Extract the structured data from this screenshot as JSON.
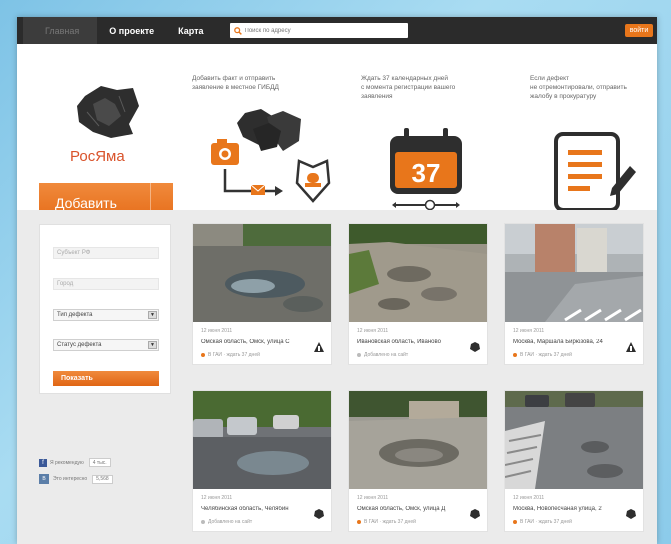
{
  "nav": {
    "tabs": [
      {
        "label": "Главная"
      },
      {
        "label": "О проекте"
      },
      {
        "label": "Карта"
      }
    ],
    "search_placeholder": "Поиск по адресу",
    "login_label": "войти"
  },
  "hero": {
    "logo_text": "РосЯма",
    "add_button": "Добавить",
    "steps": [
      {
        "text": "Добавить факт и отправить\nзаявление в местное ГИБДД"
      },
      {
        "text": "Ждать 37 календарных дней\nс момента регистрации вашего\nзаявления",
        "number": "37"
      },
      {
        "text": "Если дефект\nне отремонтировали, отправить\nжалобу в прокуратуру"
      }
    ]
  },
  "filter": {
    "region_placeholder": "Субъект РФ",
    "city_placeholder": "Город",
    "defect_type": "Тип дефекта",
    "defect_status": "Статус дефекта",
    "show_button": "Показать"
  },
  "social": {
    "fb_label": "Я рекомендую",
    "fb_count": "4 тыс.",
    "vk_label": "Это интересно",
    "vk_count": "5,568"
  },
  "cards": [
    {
      "date": "12 июня 2011",
      "address": "Омская область, Омск, улица С",
      "status": "В ГАИ  ·  ждать 37 дней"
    },
    {
      "date": "12 июня 2011",
      "address": "Ивановская область, Иваново",
      "status": "Добавлено на сайт"
    },
    {
      "date": "12 июня 2011",
      "address": "Москва, Маршала Бирюзова, 24",
      "status": "В ГАИ  ·  ждать 37 дней"
    },
    {
      "date": "12 июня 2011",
      "address": "Челябинская область, Челябин",
      "status": "Добавлено на сайт"
    },
    {
      "date": "12 июня 2011",
      "address": "Омская область, Омск, улица Д",
      "status": "В ГАИ  ·  ждать 37 дней"
    },
    {
      "date": "12 июня 2011",
      "address": "Москва, Новопесчаная улица, 2",
      "status": "В ГАИ  ·  ждать 37 дней"
    }
  ],
  "colors": {
    "accent": "#e8761b",
    "nav_bg": "#2b2b2b",
    "brand_red": "#d9532b"
  }
}
